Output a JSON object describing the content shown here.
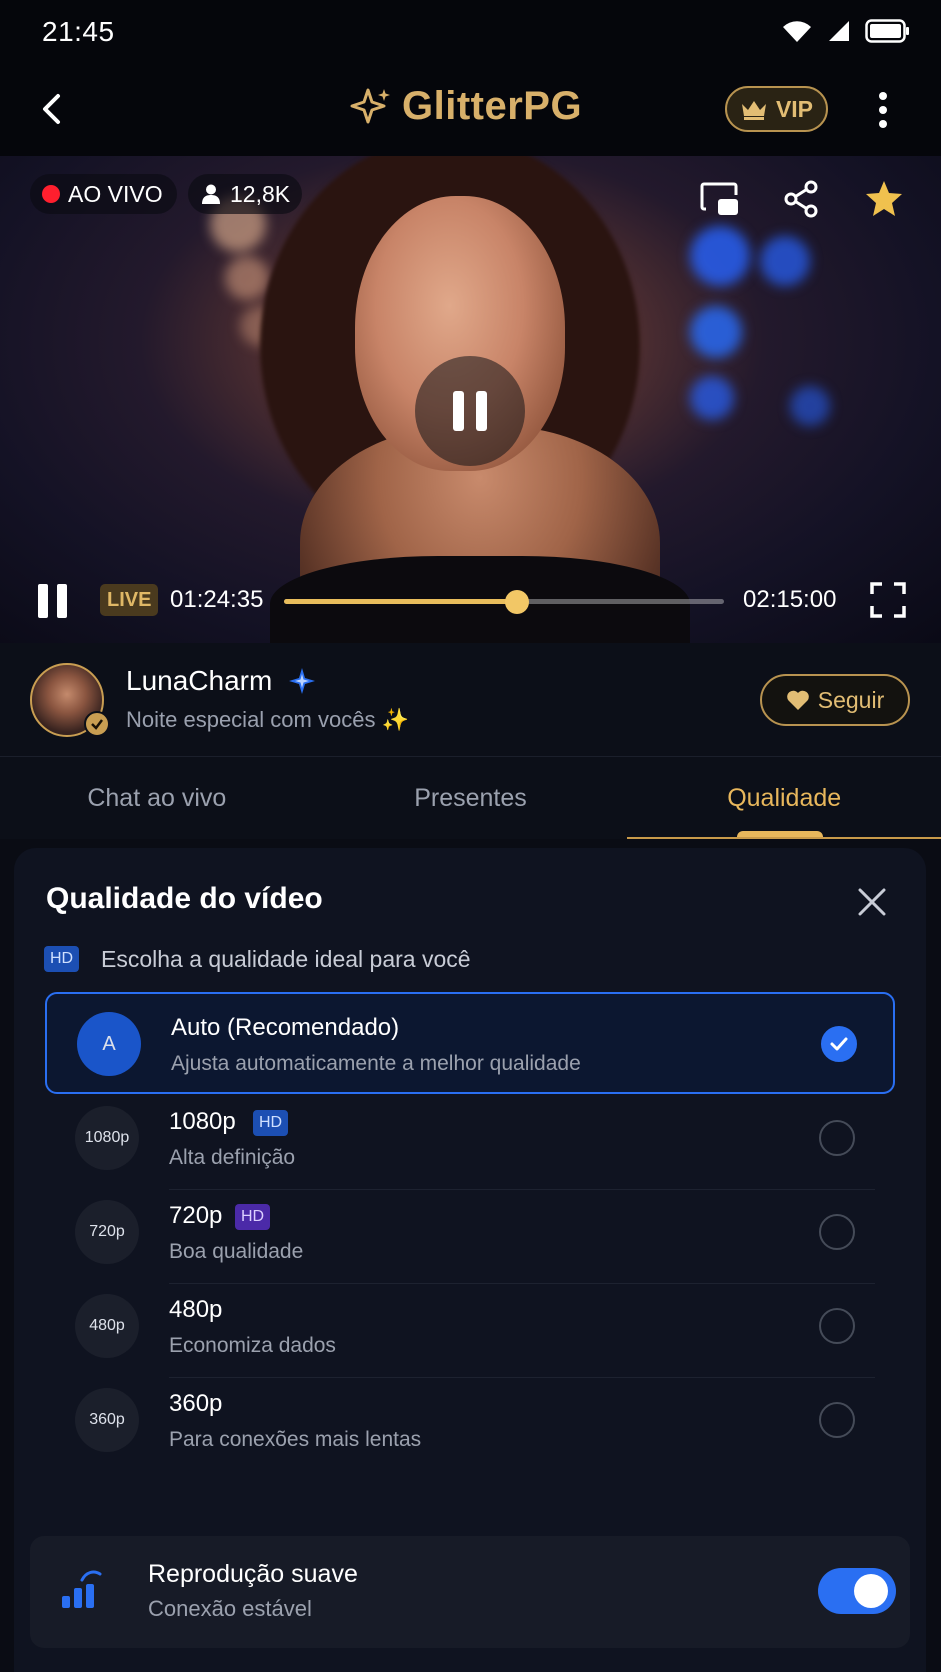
{
  "status_bar": {
    "time": "21:45"
  },
  "app": {
    "name": "GlitterPG",
    "vip_label": "VIP"
  },
  "player": {
    "live_label": "AO VIVO",
    "viewers": "12,8K",
    "live_tag": "LIVE",
    "current_time": "01:24:35",
    "total_time": "02:15:00",
    "progress": 0.53
  },
  "streamer": {
    "name": "LunaCharm",
    "subtitle": "Noite especial com vocês ✨",
    "follow_label": "Seguir"
  },
  "tabs": [
    {
      "label": "Chat ao vivo",
      "active": false
    },
    {
      "label": "Presentes",
      "active": false
    },
    {
      "label": "Qualidade",
      "active": true
    }
  ],
  "quality_sheet": {
    "title": "Qualidade do vídeo",
    "hd_badge": "HD",
    "subtitle": "Escolha a qualidade ideal para você",
    "options": [
      {
        "icon_text": "A",
        "title": "Auto (Recomendado)",
        "badge": "",
        "desc": "Ajusta automaticamente a melhor qualidade",
        "selected": true
      },
      {
        "icon_text": "1080p",
        "title": "1080p",
        "badge": "HD",
        "desc": "Alta definição",
        "selected": false
      },
      {
        "icon_text": "720p",
        "title": "720p",
        "badge": "HD",
        "desc": "Boa qualidade",
        "selected": false
      },
      {
        "icon_text": "480p",
        "title": "480p",
        "badge": "",
        "desc": "Economiza dados",
        "selected": false
      },
      {
        "icon_text": "360p",
        "title": "360p",
        "badge": "",
        "desc": "Para conexões mais lentas",
        "selected": false
      }
    ],
    "smooth": {
      "title": "Reprodução suave",
      "desc": "Conexão estável",
      "enabled": true
    }
  },
  "colors": {
    "accent_gold": "#e8b75c",
    "accent_blue": "#2a6ff2",
    "live_red": "#ff1f2e",
    "background": "#0a0c14"
  }
}
